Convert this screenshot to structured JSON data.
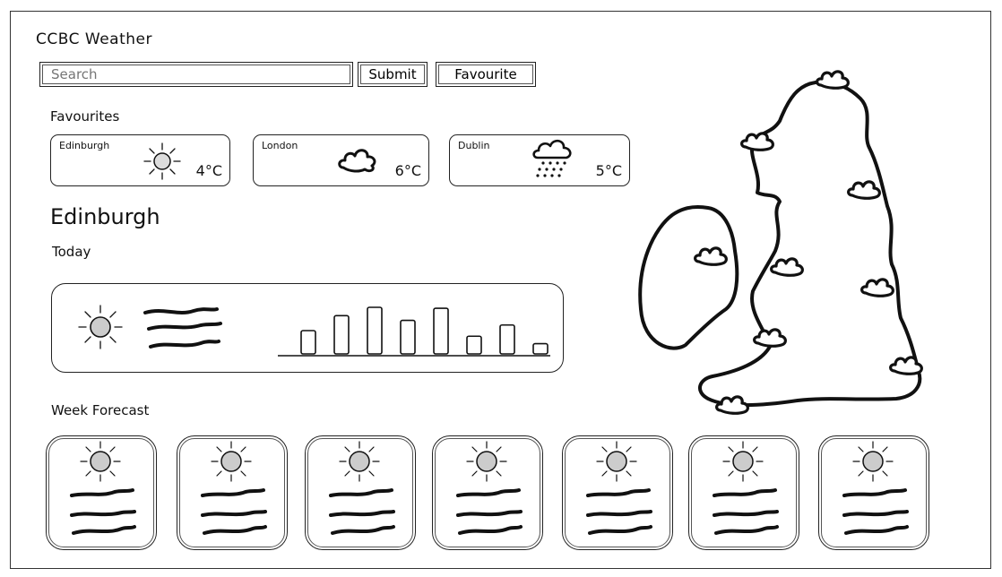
{
  "app": {
    "title": "CCBC Weather"
  },
  "search": {
    "placeholder": "Search"
  },
  "actions": {
    "submit_label": "Submit",
    "favourite_label": "Favourite"
  },
  "favourites": {
    "heading": "Favourites",
    "items": [
      {
        "city": "Edinburgh",
        "temp": "4°C",
        "icon": "sun-icon"
      },
      {
        "city": "London",
        "temp": "6°C",
        "icon": "cloud-icon"
      },
      {
        "city": "Dublin",
        "temp": "5°C",
        "icon": "snow-cloud-icon"
      }
    ]
  },
  "current": {
    "city": "Edinburgh",
    "today_label": "Today",
    "icon": "sun-icon",
    "hourly_bars": [
      0.5,
      0.82,
      1.0,
      0.72,
      0.98,
      0.38,
      0.62,
      0.22
    ]
  },
  "week": {
    "heading": "Week Forecast",
    "days": [
      {
        "icon": "sun-icon"
      },
      {
        "icon": "sun-icon"
      },
      {
        "icon": "sun-icon"
      },
      {
        "icon": "sun-icon"
      },
      {
        "icon": "sun-icon"
      },
      {
        "icon": "sun-icon"
      },
      {
        "icon": "sun-icon"
      }
    ]
  },
  "map": {
    "icon": "uk-ireland-map-icon",
    "marker_icon": "cloud-icon"
  }
}
